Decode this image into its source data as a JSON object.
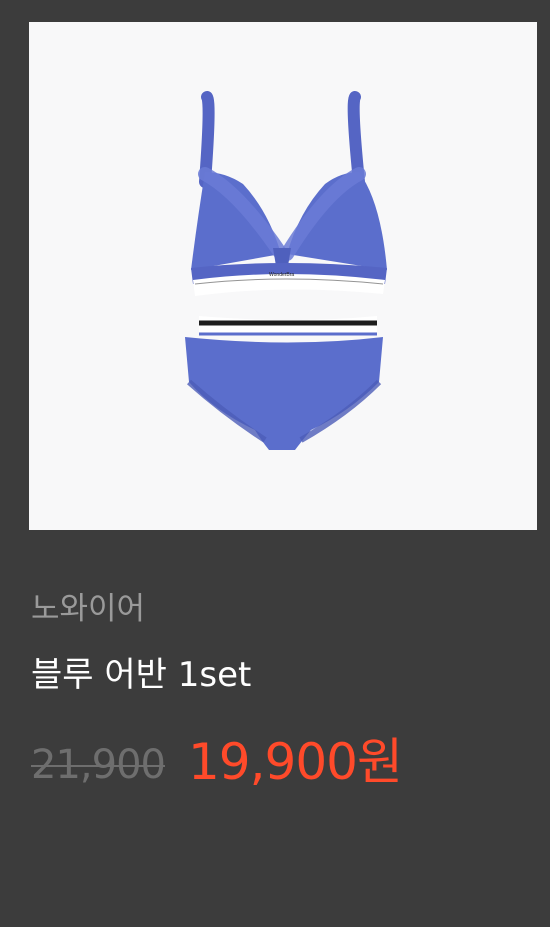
{
  "product": {
    "image_alt_icon": "lingerie-product-image",
    "brand": "노와이어",
    "name": "블루 어반 1set",
    "original_price": "21,900",
    "sale_price": "19,900원"
  },
  "colors": {
    "background": "#3c3c3c",
    "image_background": "#f8f8f9",
    "product_blue": "#5b6ecc",
    "sale_price": "#ff4a2a",
    "original_price": "#6e6e6e",
    "brand_text": "#9a9a9a",
    "name_text": "#ffffff"
  }
}
